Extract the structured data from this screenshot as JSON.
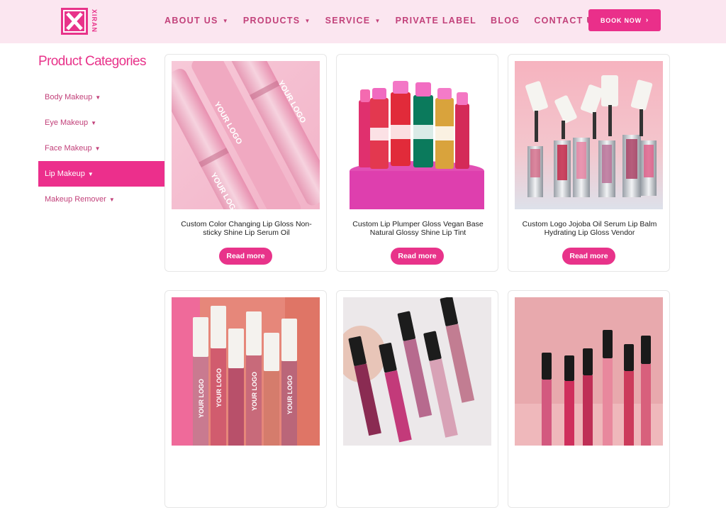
{
  "brand": {
    "name": "XIRAN",
    "color": "#e8338a"
  },
  "nav": {
    "items": [
      {
        "label": "ABOUT US",
        "dropdown": true
      },
      {
        "label": "PRODUCTS",
        "dropdown": true
      },
      {
        "label": "SERVICE",
        "dropdown": true
      },
      {
        "label": "PRIVATE LABEL",
        "dropdown": false
      },
      {
        "label": "BLOG",
        "dropdown": false
      },
      {
        "label": "CONTACT US",
        "dropdown": false
      }
    ],
    "book_label": "BOOK NOW",
    "book_icon": "chevron-right-icon"
  },
  "sidebar": {
    "title": "Product Categories",
    "items": [
      {
        "label": "Body Makeup",
        "active": false
      },
      {
        "label": "Eye Makeup",
        "active": false
      },
      {
        "label": "Face Makeup",
        "active": false
      },
      {
        "label": "Lip Makeup",
        "active": true
      },
      {
        "label": "Makeup Remover",
        "active": false
      }
    ]
  },
  "products": [
    {
      "title": "Custom Color Changing Lip Gloss Non-sticky Shine Lip Serum Oil",
      "button": "Read more"
    },
    {
      "title": "Custom Lip Plumper Gloss Vegan Base Natural Glossy Shine Lip Tint",
      "button": "Read more"
    },
    {
      "title": "Custom Logo Jojoba Oil Serum Lip Balm Hydrating Lip Gloss Vendor",
      "button": "Read more"
    },
    {
      "title": "",
      "button": ""
    },
    {
      "title": "",
      "button": ""
    },
    {
      "title": "",
      "button": ""
    }
  ],
  "colors": {
    "accent": "#e8338a",
    "nav_text": "#c2417a",
    "header_bg": "#fbe6f0",
    "active_category": "#ec2f8c"
  }
}
